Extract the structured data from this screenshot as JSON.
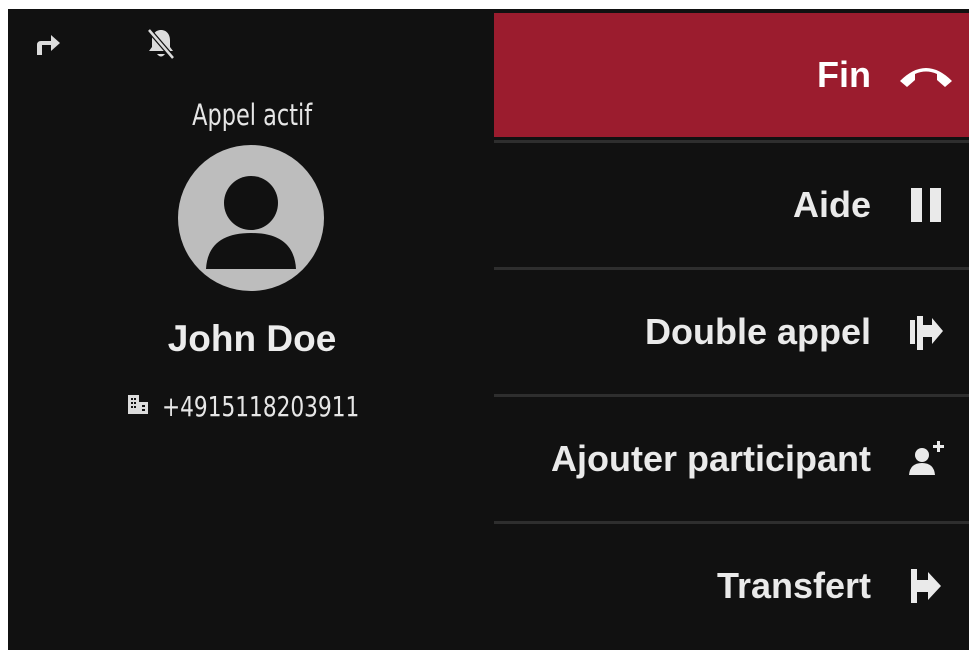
{
  "colors": {
    "background": "#111111",
    "end_call": "#9b1c2e",
    "text": "#eaeaea",
    "avatar": "#bdbdbd",
    "divider": "#2e2e2e"
  },
  "status_bar": {
    "icons": [
      "call-forward-icon",
      "bell-off-icon"
    ]
  },
  "call": {
    "status": "Appel actif",
    "contact_name": "John Doe",
    "number_icon": "building-icon",
    "number": "+4915118203911"
  },
  "actions": [
    {
      "label": "Fin",
      "icon": "hang-up-icon"
    },
    {
      "label": "Aide",
      "icon": "pause-icon"
    },
    {
      "label": "Double appel",
      "icon": "consult-call-icon"
    },
    {
      "label": "Ajouter participant",
      "icon": "add-participant-icon"
    },
    {
      "label": "Transfert",
      "icon": "transfer-icon"
    }
  ]
}
